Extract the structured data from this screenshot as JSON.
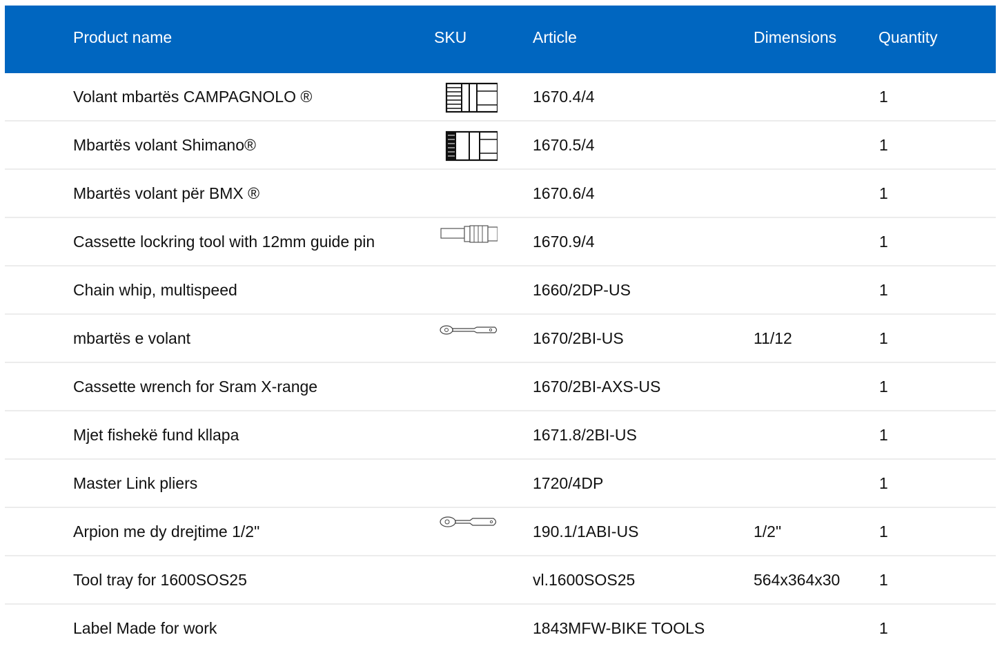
{
  "header": {
    "product_name": "Product name",
    "sku": "SKU",
    "article": "Article",
    "dimensions": "Dimensions",
    "quantity": "Quantity"
  },
  "colors": {
    "header_bg": "#0066c0",
    "header_text": "#ffffff",
    "row_divider": "#ececec"
  },
  "rows": [
    {
      "name": "Volant mbartës CAMPAGNOLO ®",
      "sku_icon": "freewheel-remover-icon",
      "article": "1670.4/4",
      "dimensions": "",
      "quantity": "1"
    },
    {
      "name": "Mbartës volant Shimano®",
      "sku_icon": "freewheel-remover-icon",
      "article": "1670.5/4",
      "dimensions": "",
      "quantity": "1"
    },
    {
      "name": "Mbartës volant për BMX ®",
      "sku_icon": "",
      "article": "1670.6/4",
      "dimensions": "",
      "quantity": "1"
    },
    {
      "name": "Cassette lockring tool with 12mm guide pin",
      "sku_icon": "lockring-tool-icon",
      "article": "1670.9/4",
      "dimensions": "",
      "quantity": "1"
    },
    {
      "name": "Chain whip, multispeed",
      "sku_icon": "",
      "article": "1660/2DP-US",
      "dimensions": "",
      "quantity": "1"
    },
    {
      "name": "mbartës e volant",
      "sku_icon": "ratchet-wrench-icon",
      "article": "1670/2BI-US",
      "dimensions": "11/12",
      "quantity": "1"
    },
    {
      "name": "Cassette wrench for Sram X-range",
      "sku_icon": "",
      "article": "1670/2BI-AXS-US",
      "dimensions": "",
      "quantity": "1"
    },
    {
      "name": "Mjet fishekë fund kllapa",
      "sku_icon": "",
      "article": "1671.8/2BI-US",
      "dimensions": "",
      "quantity": "1"
    },
    {
      "name": "Master Link pliers",
      "sku_icon": "",
      "article": "1720/4DP",
      "dimensions": "",
      "quantity": "1"
    },
    {
      "name": "Arpion me dy drejtime 1/2\"",
      "sku_icon": "ratchet-icon",
      "article": "190.1/1ABI-US",
      "dimensions": "1/2\"",
      "quantity": "1"
    },
    {
      "name": "Tool tray for 1600SOS25",
      "sku_icon": "",
      "article": "vl.1600SOS25",
      "dimensions": "564x364x30",
      "quantity": "1"
    },
    {
      "name": "Label Made for work",
      "sku_icon": "",
      "article": "1843MFW-BIKE TOOLS",
      "dimensions": "",
      "quantity": "1"
    }
  ]
}
